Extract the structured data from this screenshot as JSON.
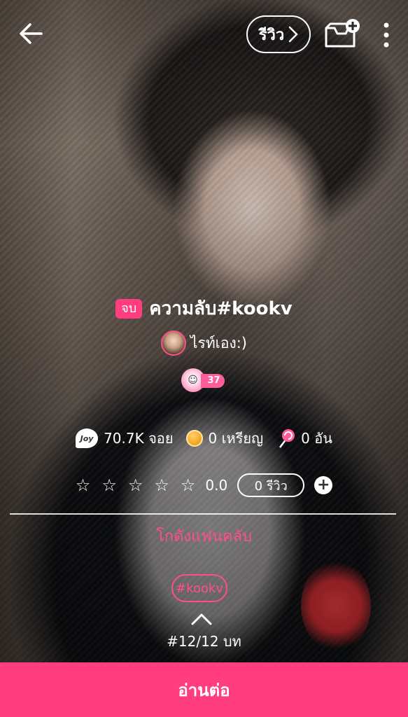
{
  "header": {
    "review_label": "รีวิว"
  },
  "story": {
    "status_badge": "จบ",
    "title": "ความลับ#kookv",
    "author": "ไรท์เอง:)",
    "level": "37"
  },
  "stats": {
    "joy": "70.7K จอย",
    "coins": "0 เหรียญ",
    "candy": "0 อัน",
    "joy_icon_text": "Joy"
  },
  "rating": {
    "stars": [
      "☆",
      "☆",
      "☆",
      "☆",
      "☆"
    ],
    "score": "0.0",
    "reviews": "0 รีวิว"
  },
  "fanclub_label": "โกดังแฟนคลับ",
  "tag": "#kookv",
  "chapters": "#12/12 บท",
  "read_button": "อ่านต่อ",
  "colors": {
    "accent": "#ff3d7f",
    "text": "#ffffff"
  },
  "icons": [
    "back-arrow-icon",
    "chevron-right-icon",
    "inbox-add-icon",
    "more-vertical-icon",
    "joy-icon",
    "coin-icon",
    "candy-icon",
    "plus-icon",
    "chevron-up-icon"
  ]
}
